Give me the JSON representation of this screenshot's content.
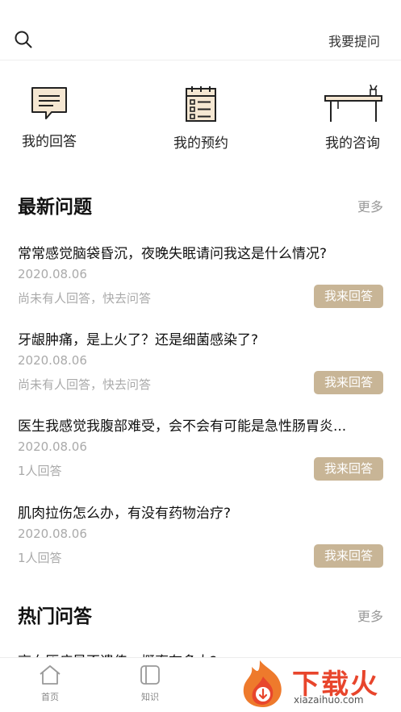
{
  "header": {
    "ask_label": "我要提问"
  },
  "quick_actions": [
    {
      "label": "我的回答"
    },
    {
      "label": "我的预约"
    },
    {
      "label": "我的咨询"
    }
  ],
  "latest": {
    "title": "最新问题",
    "more": "更多",
    "items": [
      {
        "title": "常常感觉脑袋昏沉，夜晚失眠请问我这是什么情况?",
        "date": "2020.08.06",
        "status": "尚未有人回答，快去问答",
        "button": "我来回答"
      },
      {
        "title": "牙龈肿痛，是上火了？还是细菌感染了?",
        "date": "2020.08.06",
        "status": "尚未有人回答，快去问答",
        "button": "我来回答"
      },
      {
        "title": "医生我感觉我腹部难受，会不会有可能是急性肠胃炎...",
        "date": "2020.08.06",
        "status": "1人回答",
        "button": "我来回答"
      },
      {
        "title": "肌肉拉伤怎么办，有没有药物治疗?",
        "date": "2020.08.06",
        "status": "1人回答",
        "button": "我来回答"
      }
    ]
  },
  "hot": {
    "title": "热门问答",
    "more": "更多",
    "peek": "高血压病是否遗传，概率有多大?"
  },
  "tabbar": {
    "items": [
      {
        "label": "首页"
      },
      {
        "label": "知识"
      }
    ]
  },
  "watermark": {
    "title": "下载火",
    "url": "xiazaihuo.com"
  },
  "colors": {
    "accent_button": "#c8b596",
    "watermark_red": "#e8452c"
  }
}
